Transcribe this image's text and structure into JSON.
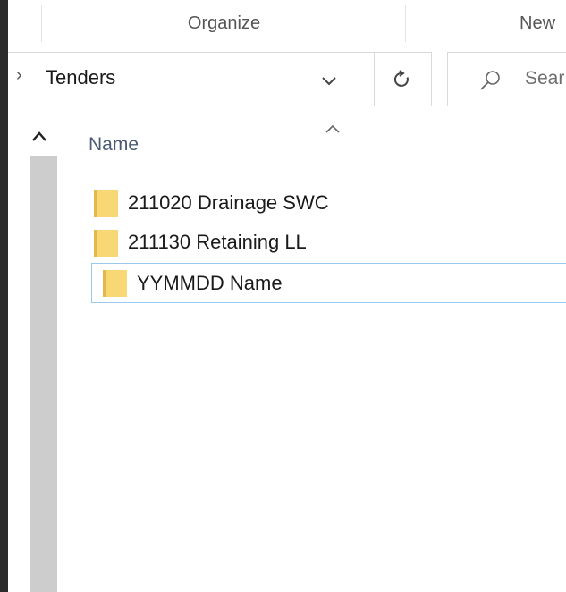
{
  "ribbon": {
    "groups": [
      "Organize",
      "New"
    ]
  },
  "address_bar": {
    "separator": "›",
    "current_folder": "Tenders",
    "dropdown_icon": "chevron-down-icon",
    "refresh_icon": "refresh-icon"
  },
  "search": {
    "placeholder": "Sear",
    "icon": "search-icon"
  },
  "nav_pane": {
    "scroll_up_icon": "chevron-up-icon"
  },
  "file_list": {
    "column_header": "Name",
    "sort_icon": "sort-ascending-icon",
    "items": [
      {
        "name": "211020 Drainage SWC",
        "icon": "folder-icon",
        "selected": false
      },
      {
        "name": "211130 Retaining LL",
        "icon": "folder-icon",
        "selected": false
      },
      {
        "name": "YYMMDD Name",
        "icon": "folder-icon",
        "selected": true
      }
    ]
  },
  "colors": {
    "folder": "#f8d775",
    "selection_border": "#99c9ef",
    "header_text": "#4a5a75"
  }
}
